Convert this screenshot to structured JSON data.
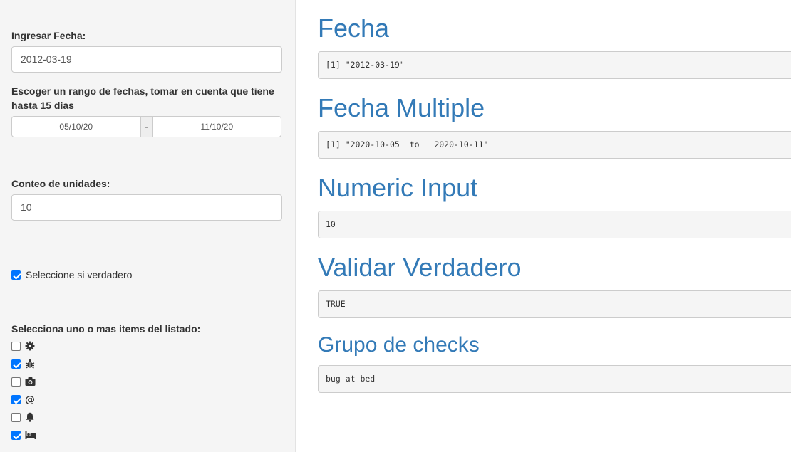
{
  "sidebar": {
    "date_label": "Ingresar Fecha:",
    "date_value": "2012-03-19",
    "range_label": "Escoger un rango de fechas, tomar en cuenta que tiene hasta 15 dias",
    "range_start": "05/10/20",
    "range_sep": "-",
    "range_end": "11/10/20",
    "count_label": "Conteo de unidades:",
    "count_value": "10",
    "checkbox_label": "Seleccione si verdadero",
    "checkbox_checked": true,
    "group_label": "Selecciona uno o mas items del listado:",
    "group_items": [
      {
        "icon": "gear-icon",
        "checked": false
      },
      {
        "icon": "bug-icon",
        "checked": true
      },
      {
        "icon": "camera-icon",
        "checked": false
      },
      {
        "icon": "at-icon",
        "checked": true
      },
      {
        "icon": "bell-icon",
        "checked": false
      },
      {
        "icon": "bed-icon",
        "checked": true
      }
    ]
  },
  "main": {
    "sections": [
      {
        "title": "Fecha",
        "output": "[1] \"2012-03-19\""
      },
      {
        "title": "Fecha Multiple",
        "output": "[1] \"2020-10-05  to   2020-10-11\""
      },
      {
        "title": "Numeric Input",
        "output": "10"
      },
      {
        "title": "Validar Verdadero",
        "output": "TRUE"
      },
      {
        "title": "Grupo de checks",
        "output": "bug at bed"
      }
    ]
  },
  "colors": {
    "heading": "#337ab7",
    "checkbox": "#0075ff",
    "sidebar_bg": "#f5f5f5"
  }
}
